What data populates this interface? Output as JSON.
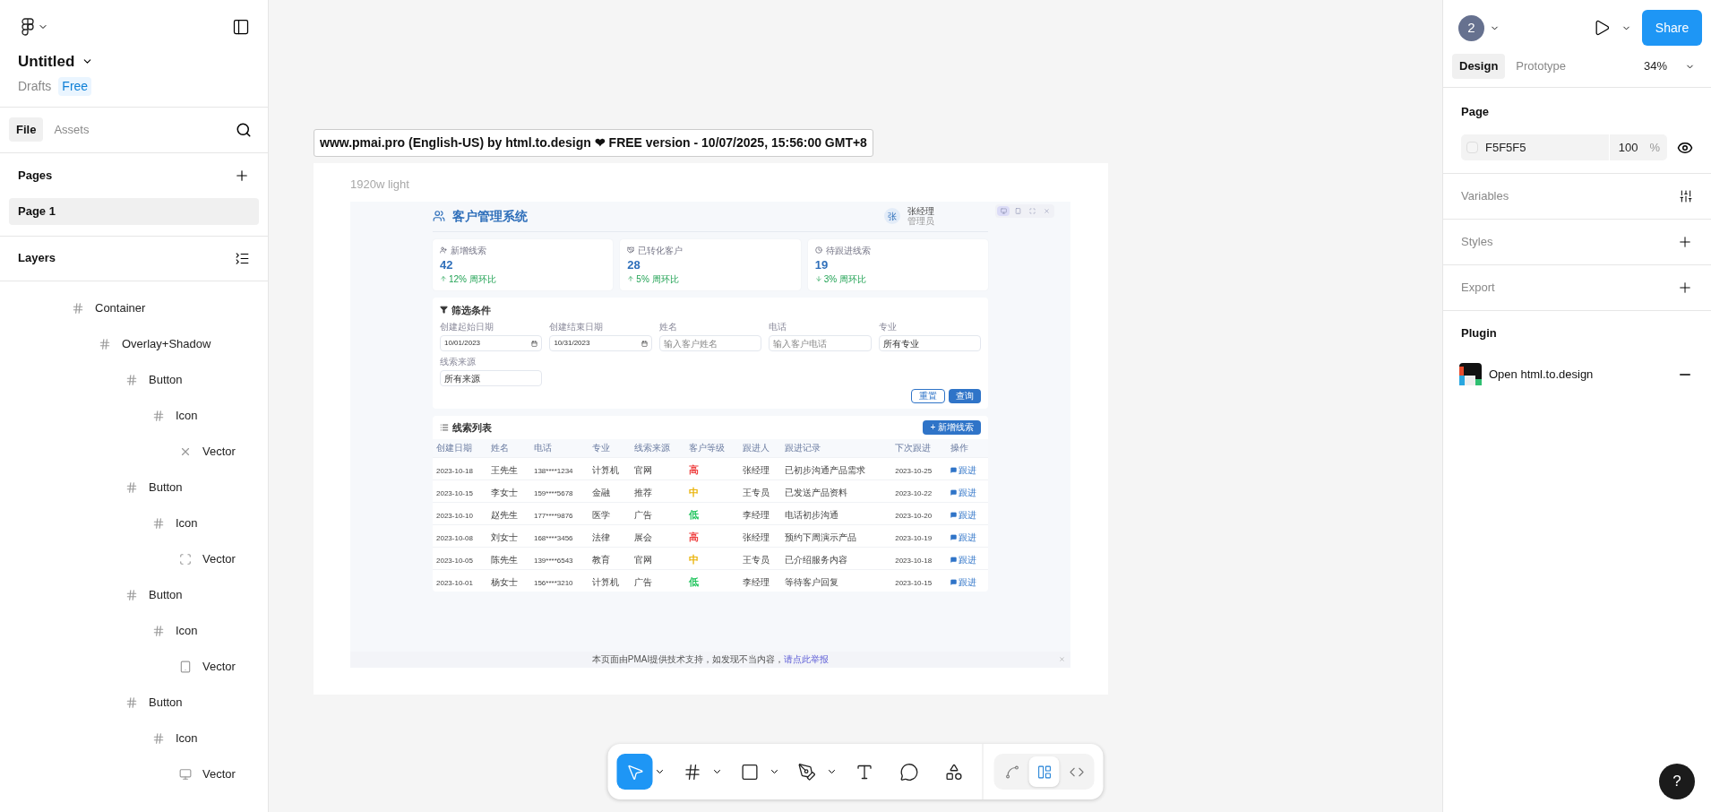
{
  "file": {
    "title": "Untitled",
    "location": "Drafts",
    "plan": "Free"
  },
  "left_tabs": [
    {
      "label": "File",
      "selected": true
    },
    {
      "label": "Assets",
      "selected": false
    }
  ],
  "pages": {
    "heading": "Pages",
    "items": [
      {
        "label": "Page 1",
        "selected": true
      }
    ]
  },
  "layers": {
    "heading": "Layers",
    "tree": [
      {
        "label": "Container",
        "kind": "frame",
        "children": [
          {
            "label": "Overlay+Shadow",
            "kind": "frame",
            "children": [
              {
                "label": "Button",
                "kind": "frame",
                "children": [
                  {
                    "label": "Icon",
                    "kind": "frame",
                    "children": [
                      {
                        "label": "Vector",
                        "kind": "cross"
                      }
                    ]
                  }
                ]
              },
              {
                "label": "Button",
                "kind": "frame",
                "children": [
                  {
                    "label": "Icon",
                    "kind": "frame",
                    "children": [
                      {
                        "label": "Vector",
                        "kind": "corners"
                      }
                    ]
                  }
                ]
              },
              {
                "label": "Button",
                "kind": "frame",
                "children": [
                  {
                    "label": "Icon",
                    "kind": "frame",
                    "children": [
                      {
                        "label": "Vector",
                        "kind": "tablet"
                      }
                    ]
                  }
                ]
              },
              {
                "label": "Button",
                "kind": "frame",
                "children": [
                  {
                    "label": "Icon",
                    "kind": "frame",
                    "children": [
                      {
                        "label": "Vector",
                        "kind": "monitor"
                      }
                    ]
                  }
                ]
              }
            ]
          }
        ]
      }
    ]
  },
  "canvas": {
    "frame_label": "www.pmai.pro (English-US) by html.to.design ❤ FREE version - 10/07/2025, 15:56:00 GMT+8",
    "frame_name": "1920w light",
    "mockup": {
      "title": "客户管理系统",
      "user": {
        "avatar": "张",
        "name": "张经理",
        "role": "管理员"
      },
      "view_buttons": [
        {
          "kind": "monitor",
          "selected": true
        },
        {
          "kind": "tablet",
          "selected": false
        },
        {
          "kind": "fullscreen",
          "selected": false
        },
        {
          "kind": "close",
          "selected": false
        }
      ],
      "stats": [
        {
          "kind": "user-plus",
          "label": "新增线索",
          "value": "42",
          "trend": "12% 周环比",
          "rising": true
        },
        {
          "kind": "handshake",
          "label": "已转化客户",
          "value": "28",
          "trend": "5% 周环比",
          "rising": true
        },
        {
          "kind": "clock",
          "label": "待跟进线索",
          "value": "19",
          "trend": "3% 周环比",
          "rising": false
        }
      ],
      "filter": {
        "title": "筛选条件",
        "fields": [
          {
            "label": "创建起始日期",
            "kind": "date",
            "value": "10/01/2023"
          },
          {
            "label": "创建结束日期",
            "kind": "date",
            "value": "10/31/2023"
          },
          {
            "label": "姓名",
            "kind": "text",
            "placeholder": "输入客户姓名"
          },
          {
            "label": "电话",
            "kind": "text",
            "placeholder": "输入客户电话"
          },
          {
            "label": "专业",
            "kind": "select",
            "value": "所有专业"
          },
          {
            "label": "线索来源",
            "kind": "select",
            "value": "所有来源"
          }
        ],
        "buttons": [
          {
            "label": "重置",
            "kind": "secondary"
          },
          {
            "label": "查询",
            "kind": "primary"
          }
        ]
      },
      "leads": {
        "title": "线索列表",
        "add_button": "+ 新增线索",
        "columns": [
          "创建日期",
          "姓名",
          "电话",
          "专业",
          "线索来源",
          "客户等级",
          "跟进人",
          "跟进记录",
          "下次跟进",
          "操作"
        ],
        "rows": [
          {
            "cells": [
              "2023-10-18",
              "王先生",
              "138****1234",
              "计算机",
              "官网",
              "高",
              "张经理",
              "已初步沟通产品需求",
              "2023-10-25"
            ],
            "color": "#ef4444",
            "action": "跟进"
          },
          {
            "cells": [
              "2023-10-15",
              "李女士",
              "159****5678",
              "金融",
              "推荐",
              "中",
              "王专员",
              "已发送产品资料",
              "2023-10-22"
            ],
            "color": "#eab308",
            "action": "跟进"
          },
          {
            "cells": [
              "2023-10-10",
              "赵先生",
              "177****9876",
              "医学",
              "广告",
              "低",
              "李经理",
              "电话初步沟通",
              "2023-10-20"
            ],
            "color": "#22c55e",
            "action": "跟进"
          },
          {
            "cells": [
              "2023-10-08",
              "刘女士",
              "168****3456",
              "法律",
              "展会",
              "高",
              "张经理",
              "预约下周演示产品",
              "2023-10-19"
            ],
            "color": "#ef4444",
            "action": "跟进"
          },
          {
            "cells": [
              "2023-10-05",
              "陈先生",
              "139****6543",
              "教育",
              "官网",
              "中",
              "王专员",
              "已介绍服务内容",
              "2023-10-18"
            ],
            "color": "#eab308",
            "action": "跟进"
          },
          {
            "cells": [
              "2023-10-01",
              "杨女士",
              "156****3210",
              "计算机",
              "广告",
              "低",
              "李经理",
              "等待客户回复",
              "2023-10-15"
            ],
            "color": "#22c55e",
            "action": "跟进"
          }
        ]
      },
      "footer": {
        "notice": "本页面由PMAI提供技术支持，如发现不当内容，",
        "link": "请点此举报"
      }
    }
  },
  "toolbar": {
    "tools": [
      {
        "kind": "move",
        "selected": true,
        "menu": true
      },
      {
        "kind": "frame",
        "selected": false,
        "menu": true
      },
      {
        "kind": "shape",
        "selected": false,
        "menu": true
      },
      {
        "kind": "pen",
        "selected": false,
        "menu": true
      },
      {
        "kind": "text",
        "selected": false,
        "menu": false
      },
      {
        "kind": "comment",
        "selected": false,
        "menu": false
      },
      {
        "kind": "actions",
        "selected": false,
        "menu": false
      }
    ],
    "modes": [
      {
        "kind": "draw",
        "selected": false
      },
      {
        "kind": "design",
        "selected": true
      },
      {
        "kind": "dev",
        "selected": false
      }
    ]
  },
  "right_panel": {
    "collaborators": "2",
    "share": "Share",
    "tabs": [
      {
        "label": "Design",
        "selected": true
      },
      {
        "label": "Prototype",
        "selected": false
      }
    ],
    "zoom": "34%",
    "page": {
      "heading": "Page",
      "color": "F5F5F5",
      "opacity": "100",
      "unit": "%"
    },
    "sections": [
      {
        "label": "Variables",
        "kind": "variables"
      },
      {
        "label": "Styles",
        "kind": "add"
      },
      {
        "label": "Export",
        "kind": "add"
      }
    ],
    "plugin": {
      "heading": "Plugin",
      "label": "Open html.to.design"
    }
  },
  "help": "?"
}
